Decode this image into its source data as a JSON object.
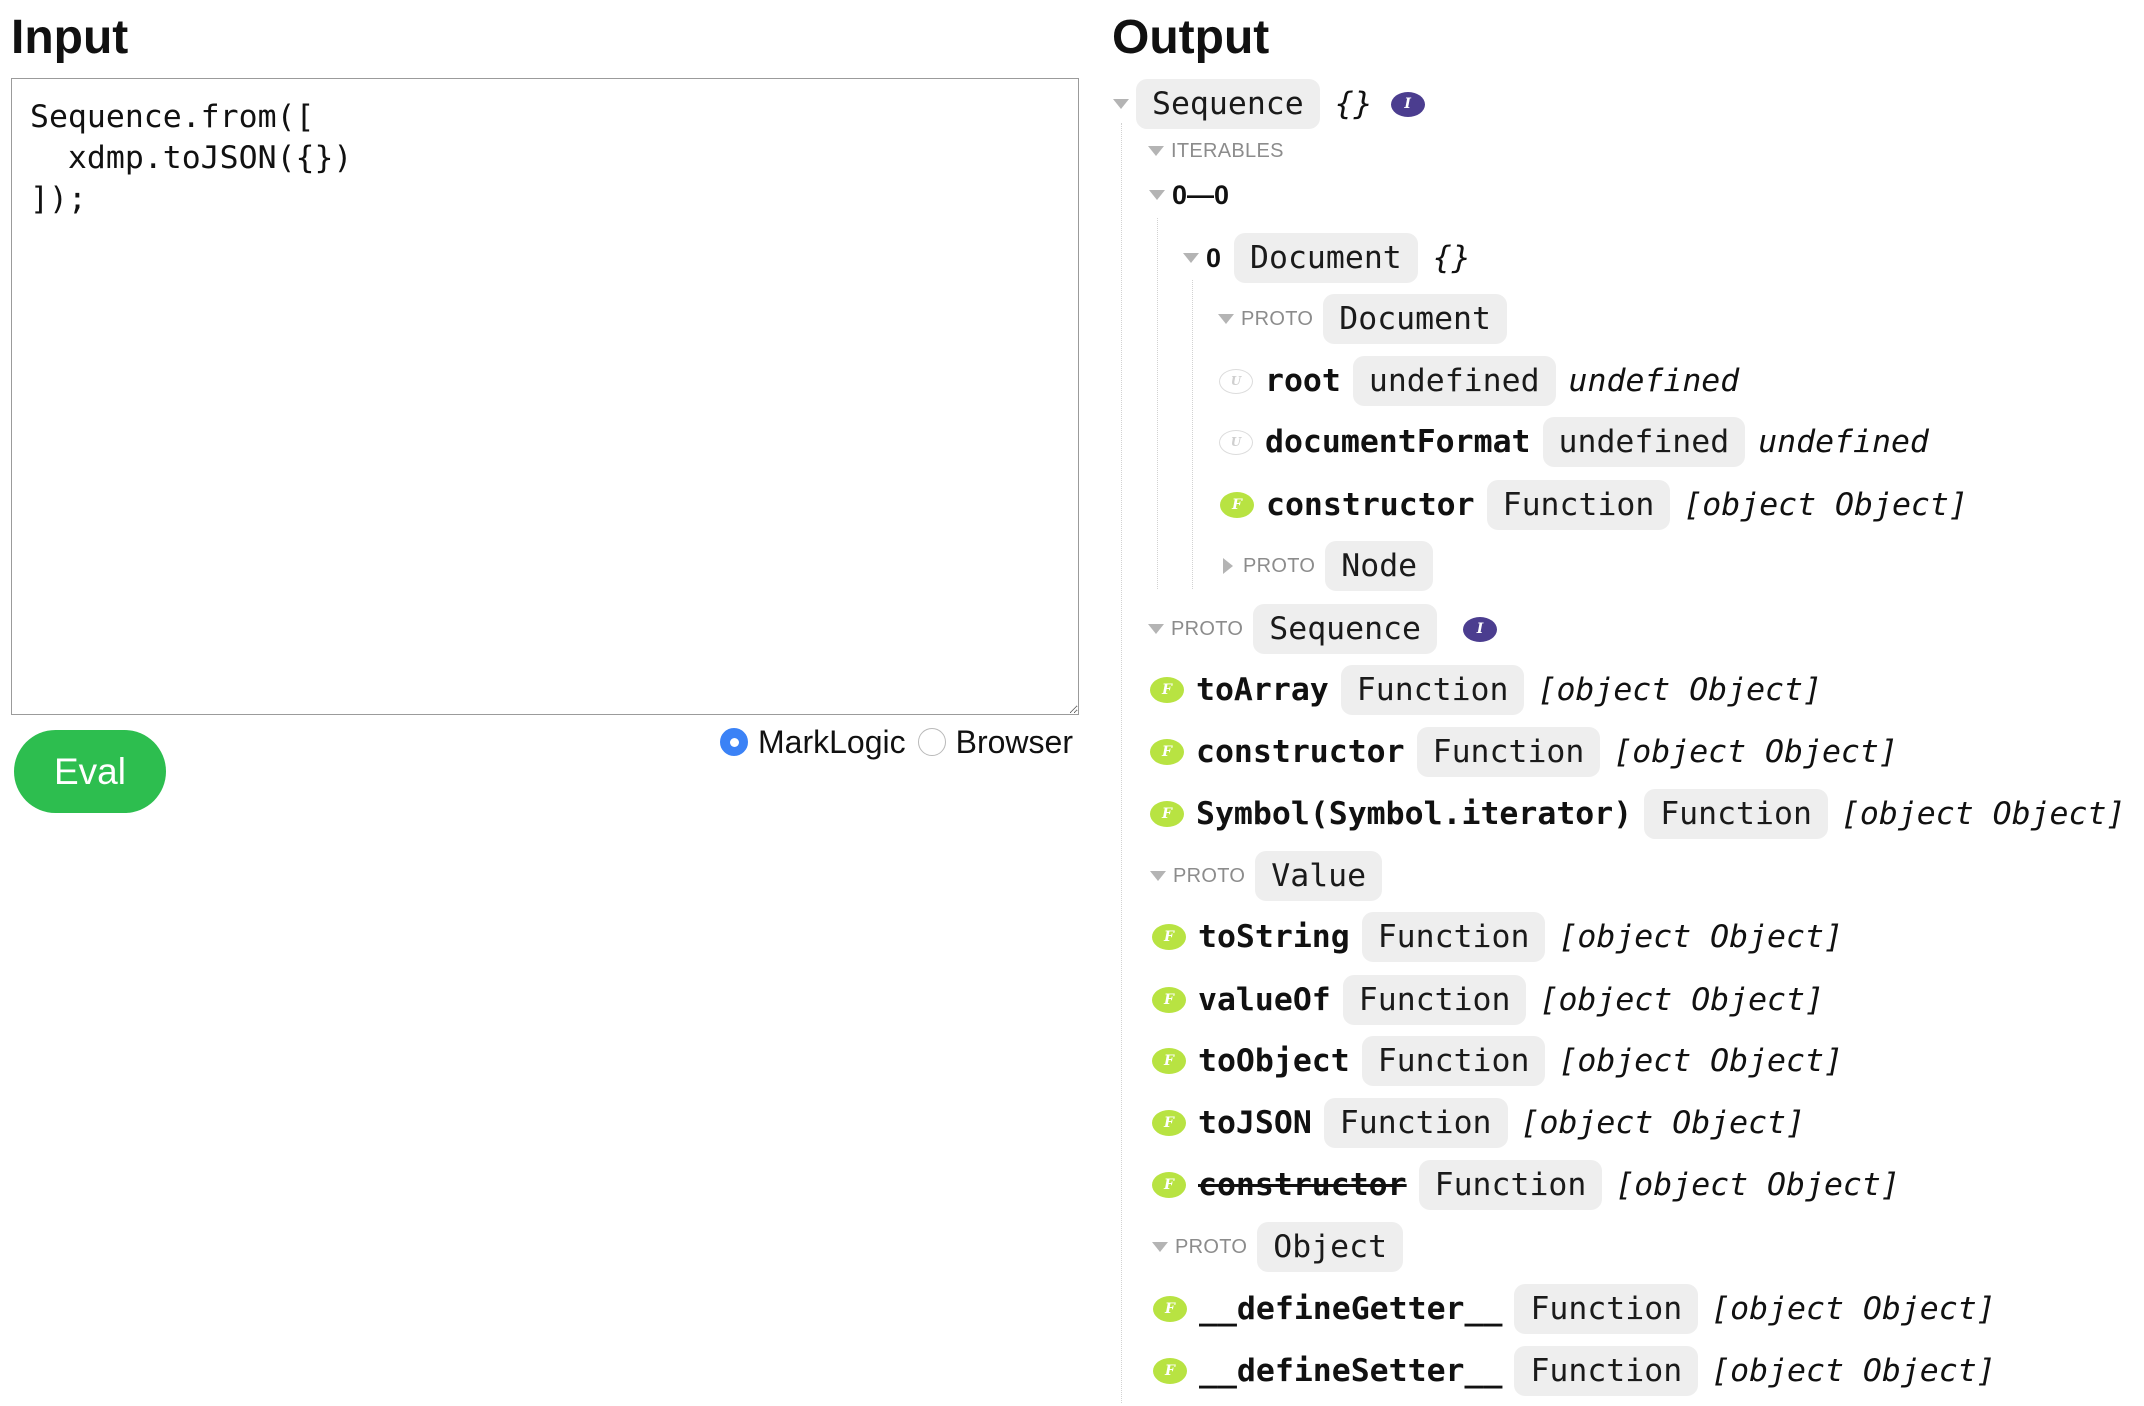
{
  "input": {
    "heading": "Input",
    "code": "Sequence.from([\n  xdmp.toJSON({})\n]);",
    "eval_label": "Eval",
    "modes": [
      {
        "label": "MarkLogic",
        "selected": true
      },
      {
        "label": "Browser",
        "selected": false
      }
    ]
  },
  "output": {
    "heading": "Output",
    "tree": [
      {
        "toggle": "expanded",
        "type": "Sequence",
        "value": "{}",
        "badge": "I"
      },
      {
        "toggle": "expanded",
        "label": "ITERABLES"
      },
      {
        "toggle": "expanded",
        "label": "0—0"
      },
      {
        "toggle": "expanded",
        "key": "0",
        "type": "Document",
        "value": "{}"
      },
      {
        "toggle": "expanded",
        "label": "PROTO",
        "type": "Document"
      },
      {
        "badge": "U",
        "key": "root",
        "type": "undefined",
        "value": "undefined"
      },
      {
        "badge": "U",
        "key": "documentFormat",
        "type": "undefined",
        "value": "undefined"
      },
      {
        "badge": "F",
        "key": "constructor",
        "type": "Function",
        "value": "[object Object]"
      },
      {
        "toggle": "collapsed",
        "label": "PROTO",
        "type": "Node"
      },
      {
        "toggle": "expanded",
        "label": "PROTO",
        "type": "Sequence",
        "badge": "I"
      },
      {
        "badge": "F",
        "key": "toArray",
        "type": "Function",
        "value": "[object Object]"
      },
      {
        "badge": "F",
        "key": "constructor",
        "type": "Function",
        "value": "[object Object]"
      },
      {
        "badge": "F",
        "key": "Symbol(Symbol.iterator)",
        "type": "Function",
        "value": "[object Object]"
      },
      {
        "toggle": "expanded",
        "label": "PROTO",
        "type": "Value"
      },
      {
        "badge": "F",
        "key": "toString",
        "type": "Function",
        "value": "[object Object]"
      },
      {
        "badge": "F",
        "key": "valueOf",
        "type": "Function",
        "value": "[object Object]"
      },
      {
        "badge": "F",
        "key": "toObject",
        "type": "Function",
        "value": "[object Object]"
      },
      {
        "badge": "F",
        "key": "toJSON",
        "type": "Function",
        "value": "[object Object]"
      },
      {
        "badge": "F",
        "key": "constructor",
        "type": "Function",
        "value": "[object Object]",
        "struck_through": true
      },
      {
        "toggle": "expanded",
        "label": "PROTO",
        "type": "Object"
      },
      {
        "badge": "F",
        "key": "__defineGetter__",
        "type": "Function",
        "value": "[object Object]"
      },
      {
        "badge": "F",
        "key": "__defineSetter__",
        "type": "Function",
        "value": "[object Object]"
      }
    ]
  },
  "icons": {
    "expanded_toggle": "triangle-down-icon",
    "collapsed_toggle": "triangle-right-icon",
    "iterable_badge": "iterable-badge-icon",
    "function_badge": "function-badge-icon",
    "undefined_badge": "undefined-badge-icon"
  },
  "colors": {
    "eval_button": "#2dbe4f",
    "iterable_badge": "#4b3d8f",
    "function_badge": "#b8e342",
    "radio_selected": "#3b82f6",
    "pill_background": "#eeeeee"
  }
}
